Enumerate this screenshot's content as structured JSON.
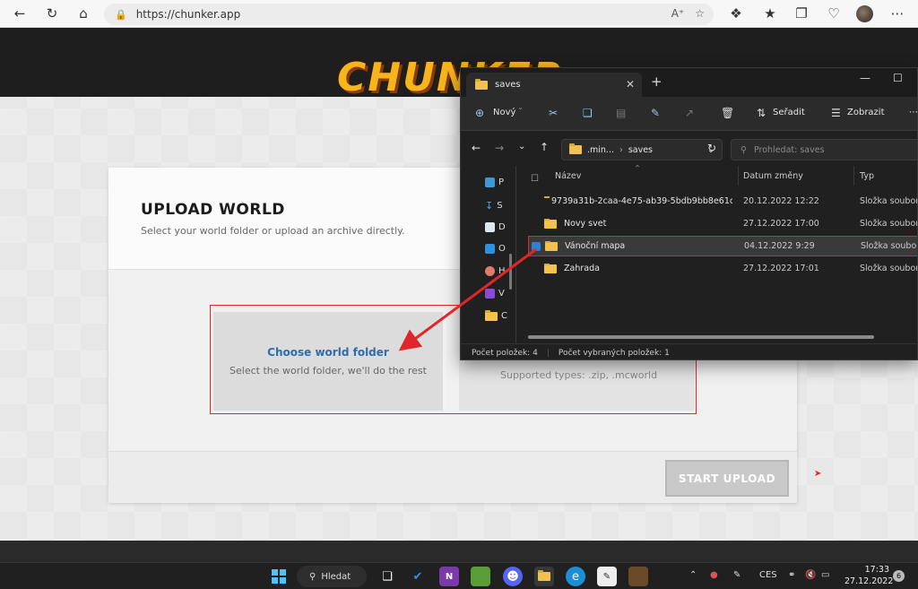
{
  "browser": {
    "url": "https://chunker.app"
  },
  "page": {
    "logo_text": "CHUNKER",
    "title": "UPLOAD WORLD",
    "subtitle": "Select your world folder or upload an archive directly.",
    "choose_title": "Choose world folder",
    "choose_sub": "Select the world folder, we'll do the rest",
    "upload_sub": "Supported types: .zip, .mcworld",
    "start_button": "START UPLOAD"
  },
  "explorer": {
    "tab_title": "saves",
    "toolbar": {
      "new_label": "Nový",
      "sort_label": "Seřadit",
      "view_label": "Zobrazit"
    },
    "path": {
      "part1": ".min...",
      "part2": "saves"
    },
    "search_placeholder": "Prohledat: saves",
    "columns": {
      "name": "Název",
      "date": "Datum změny",
      "type": "Typ"
    },
    "sidebar": [
      "P",
      "S",
      "D",
      "O",
      "H",
      "V",
      "C"
    ],
    "rows": [
      {
        "name": "9739a31b-2caa-4e75-ab39-5bdb9bb8e61c",
        "date": "20.12.2022 12:22",
        "type": "Složka souborů"
      },
      {
        "name": "Novy svet",
        "date": "27.12.2022 17:00",
        "type": "Složka souborů"
      },
      {
        "name": "Vánoční mapa",
        "date": "04.12.2022 9:29",
        "type": "Složka souborů"
      },
      {
        "name": "Zahrada",
        "date": "27.12.2022 17:01",
        "type": "Složka souborů"
      }
    ],
    "status": {
      "count": "Počet položek: 4",
      "selected": "Počet vybraných položek: 1"
    }
  },
  "taskbar": {
    "search_label": "Hledat",
    "language": "CES",
    "time": "17:33",
    "date": "27.12.2022",
    "notifications": "6"
  },
  "colors": {
    "accent_blue": "#2d6dab",
    "annotation_red": "#e0262b",
    "logo_gold": "#f7b51c"
  }
}
